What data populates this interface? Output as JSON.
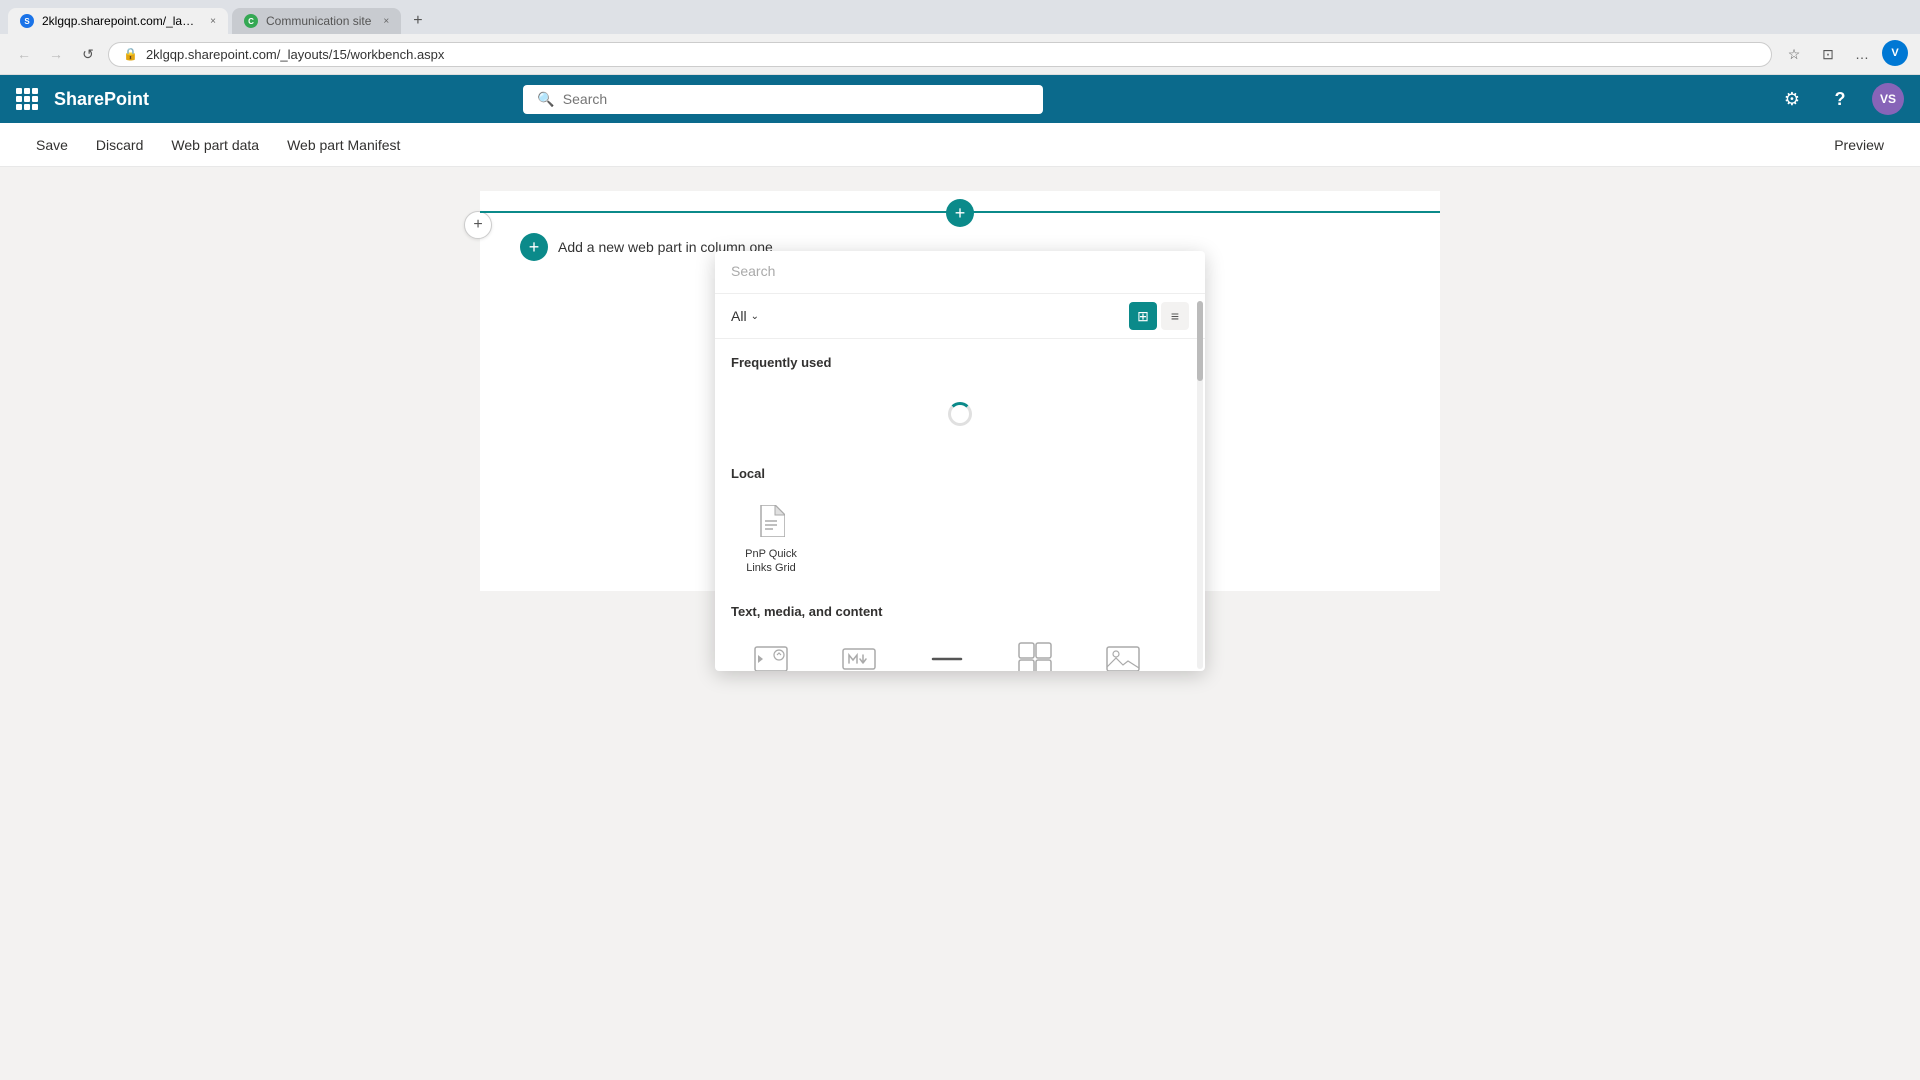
{
  "browser": {
    "tabs": [
      {
        "id": "tab1",
        "favicon": "🔵",
        "label": "2klgqp.sharepoint.com/_layout...",
        "active": true,
        "close": "×"
      },
      {
        "id": "tab2",
        "favicon": "🟢",
        "label": "Communication site",
        "active": false,
        "close": "×"
      }
    ],
    "new_tab_icon": "+",
    "nav": {
      "back_disabled": true,
      "back_icon": "←",
      "forward_disabled": true,
      "forward_icon": "→",
      "reload_icon": "↺",
      "url": "2klgqp.sharepoint.com/_layouts/15/workbench.aspx"
    },
    "address_icon": "🔒",
    "right_icons": [
      "☆",
      "⊡",
      "…"
    ],
    "user_initials": "V"
  },
  "sharepoint": {
    "waffle_icon": "waffle",
    "logo": "SharePoint",
    "search_placeholder": "Search",
    "header_icons": [
      "settings",
      "help"
    ],
    "settings_icon": "⚙",
    "help_icon": "?",
    "user_initials": "VS"
  },
  "toolbar": {
    "save_label": "Save",
    "discard_label": "Discard",
    "webpart_data_label": "Web part data",
    "webpart_manifest_label": "Web part Manifest",
    "preview_label": "Preview"
  },
  "canvas": {
    "add_section_icon": "+",
    "column_add_icon": "+",
    "add_webpart_text": "Add a new web part in column one"
  },
  "picker": {
    "search_placeholder": "Search",
    "filter_label": "All",
    "filter_chevron": "⌄",
    "view_grid_icon": "⊞",
    "view_list_icon": "≡",
    "sections": [
      {
        "id": "frequently_used",
        "label": "Frequently used",
        "loading": true,
        "items": []
      },
      {
        "id": "local",
        "label": "Local",
        "loading": false,
        "items": [
          {
            "id": "pnp_quick",
            "icon": "📄",
            "label": "PnP Quick\nLinks Grid"
          }
        ]
      },
      {
        "id": "text_media",
        "label": "Text, media, and content",
        "loading": false,
        "items": [
          {
            "id": "embed",
            "icon": "embed",
            "label": ""
          },
          {
            "id": "markdown",
            "icon": "markdown",
            "label": ""
          },
          {
            "id": "divider",
            "icon": "divider",
            "label": ""
          },
          {
            "id": "quick_chart",
            "icon": "quick_chart",
            "label": ""
          },
          {
            "id": "image",
            "icon": "image",
            "label": ""
          }
        ]
      }
    ]
  }
}
